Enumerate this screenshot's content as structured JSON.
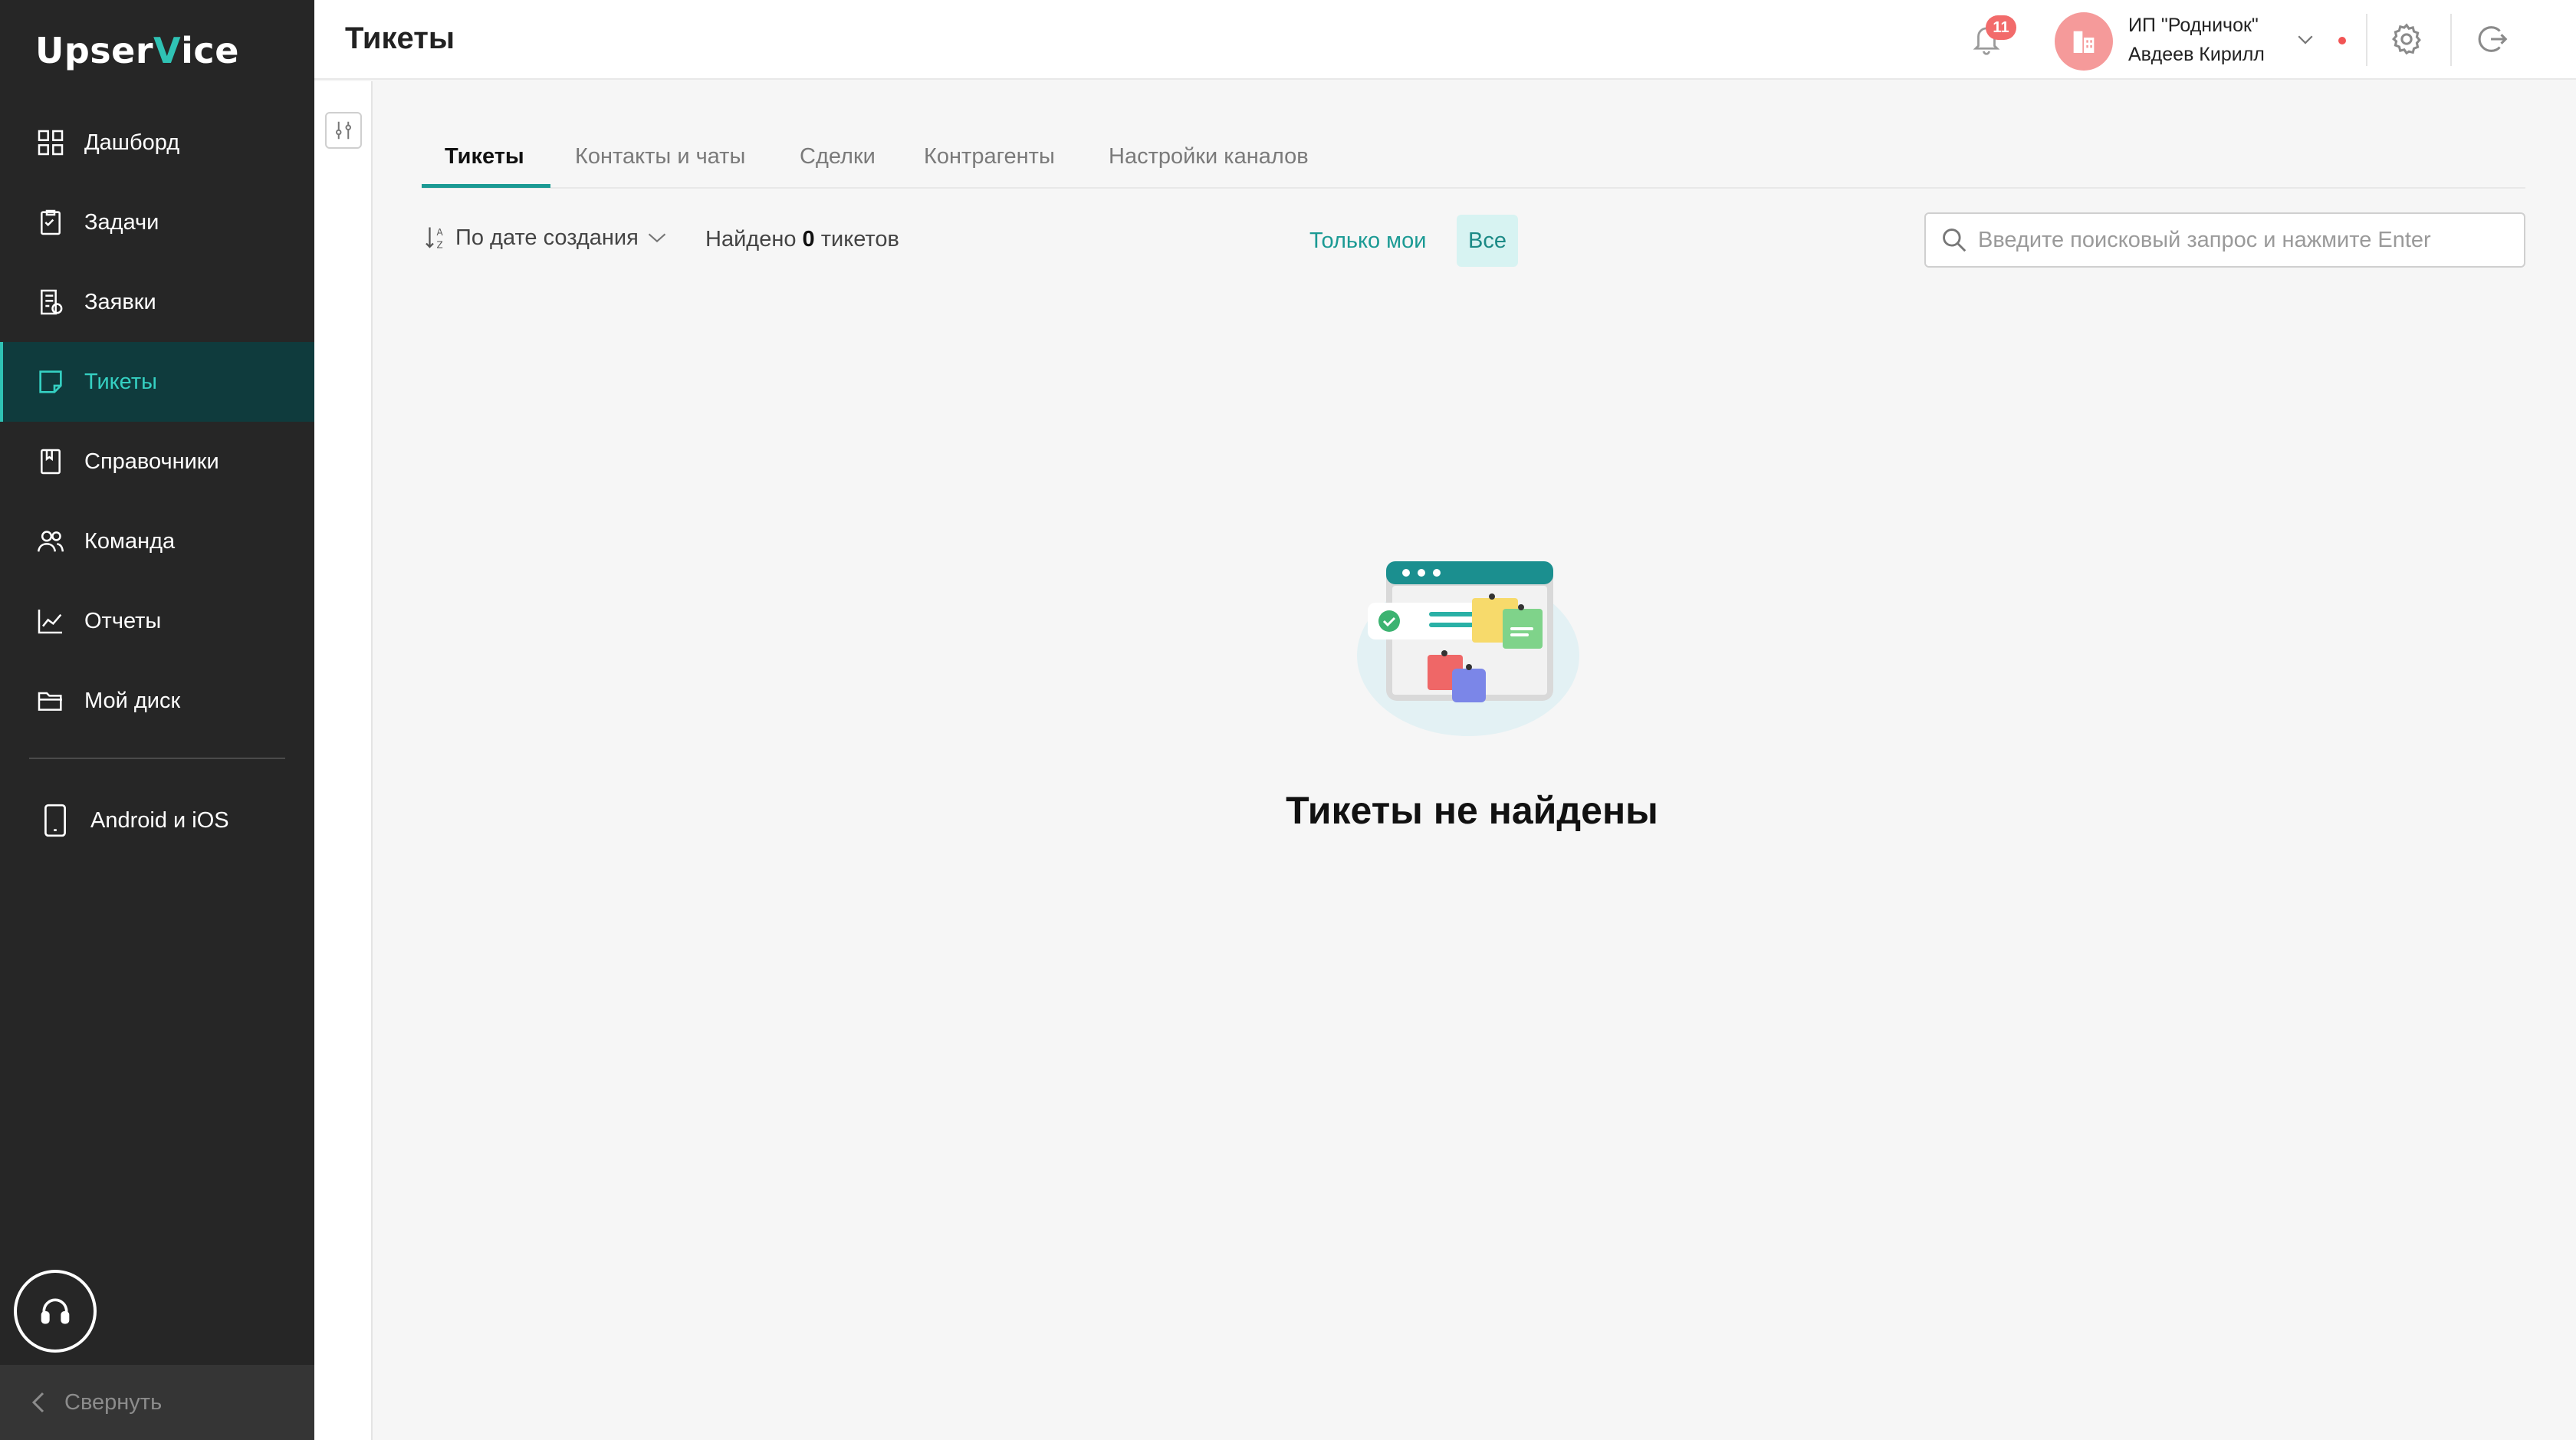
{
  "app": {
    "logo_text_pre": "Upser",
    "logo_text_check": "V",
    "logo_text_post": "ice"
  },
  "sidebar": {
    "items": [
      {
        "label": "Дашборд",
        "icon": "dashboard-icon"
      },
      {
        "label": "Задачи",
        "icon": "tasks-icon"
      },
      {
        "label": "Заявки",
        "icon": "requests-icon"
      },
      {
        "label": "Тикеты",
        "icon": "tickets-icon",
        "active": true
      },
      {
        "label": "Справочники",
        "icon": "book-icon"
      },
      {
        "label": "Команда",
        "icon": "team-icon"
      },
      {
        "label": "Отчеты",
        "icon": "chart-icon"
      },
      {
        "label": "Мой диск",
        "icon": "folder-icon"
      }
    ],
    "mobile": {
      "label": "Android и iOS",
      "icon": "phone-icon"
    },
    "collapse_label": "Свернуть"
  },
  "header": {
    "title": "Тикеты",
    "notifications_count": "11",
    "org_name": "ИП \"Родничок\"",
    "user_name": "Авдеев Кирилл"
  },
  "tabs": [
    {
      "label": "Тикеты",
      "active": true
    },
    {
      "label": "Контакты и чаты"
    },
    {
      "label": "Сделки"
    },
    {
      "label": "Контрагенты"
    },
    {
      "label": "Настройки каналов"
    }
  ],
  "toolbar": {
    "sort_label": "По дате создания",
    "found_prefix": "Найдено",
    "found_count": "0",
    "found_suffix": "тикетов",
    "only_mine": "Только мои",
    "all": "Все",
    "search_placeholder": "Введите поисковый запрос и нажмите Enter"
  },
  "empty_state": {
    "message": "Тикеты не найдены"
  },
  "colors": {
    "accent": "#1b9a94",
    "sidebar_bg": "#262626",
    "active_bg": "#0f3b3d",
    "badge": "#f26b6b"
  }
}
